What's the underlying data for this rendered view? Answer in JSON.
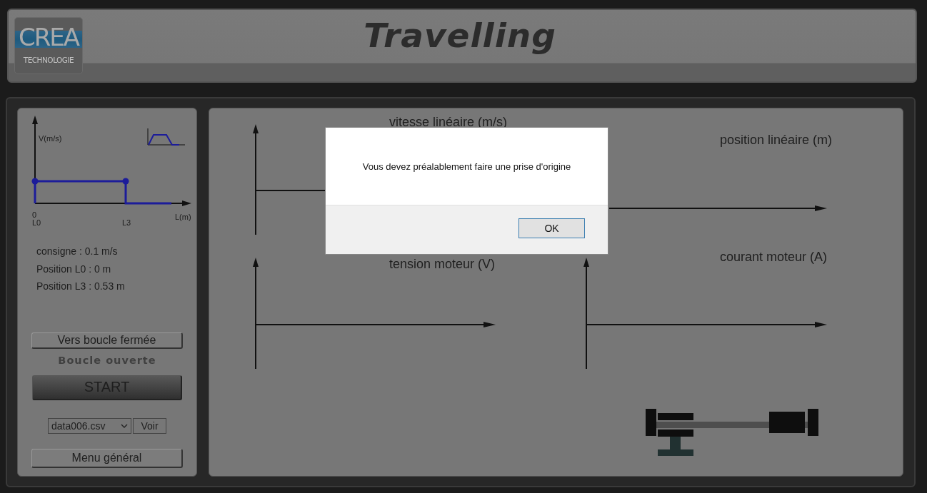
{
  "header": {
    "logo": {
      "main": "CREA",
      "sub": "TECHNOLOGIE"
    },
    "title": "Travelling"
  },
  "profile": {
    "y_label": "V(m/s)",
    "x_label": "L(m)",
    "origin": "0",
    "start_label": "L0",
    "end_label": "L3"
  },
  "info": [
    "consigne : 0.1 m/s",
    "Position L0 : 0 m",
    "Position L3 : 0.53 m"
  ],
  "mode_button": "Vers boucle fermée",
  "mode_status": "Boucle ouverte",
  "start_button": "START",
  "file_select": {
    "value": "data006.csv"
  },
  "view_button": "Voir",
  "menu_button": "Menu général",
  "charts": [
    {
      "title": "vitesse linéaire (m/s)"
    },
    {
      "title": "position linéaire (m)"
    },
    {
      "title": "tension moteur (V)"
    },
    {
      "title": "courant moteur (A)"
    }
  ],
  "dialog": {
    "message": "Vous devez préalablement faire une prise d'origine",
    "button": "OK"
  }
}
